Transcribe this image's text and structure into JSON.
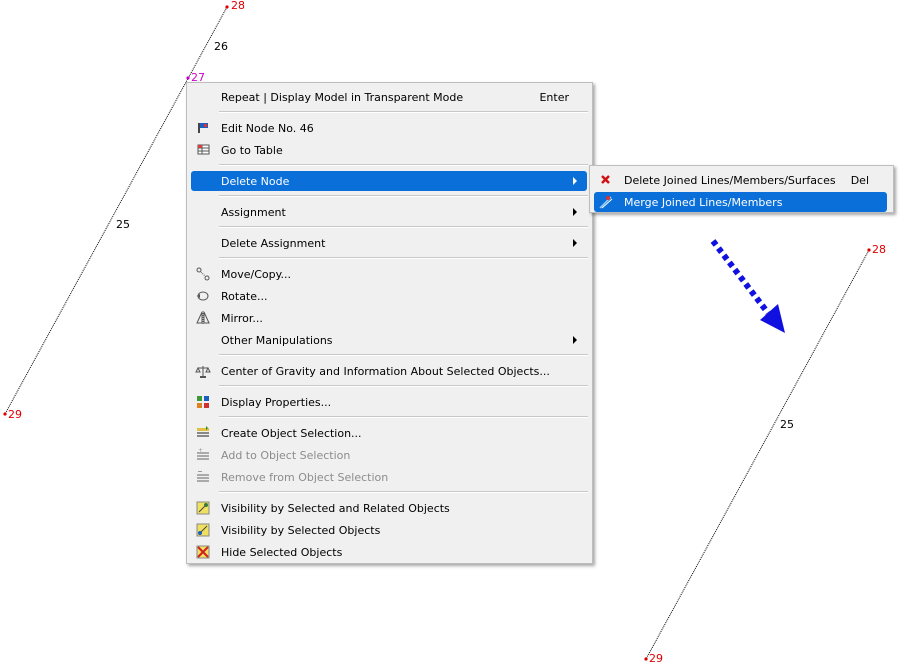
{
  "viewport": {
    "nodes_left": {
      "n28": "28",
      "n27": "27",
      "n29": "29"
    },
    "lines_left": {
      "a": "26",
      "b": "25"
    },
    "nodes_right": {
      "n28": "28",
      "n29": "29"
    },
    "lines_right": {
      "a": "25"
    }
  },
  "context_menu": {
    "repeat": {
      "label": "Repeat | Display Model in Transparent Mode",
      "shortcut": "Enter"
    },
    "edit_node": "Edit Node No. 46",
    "go_to_table": "Go to Table",
    "delete_node": "Delete Node",
    "assignment": "Assignment",
    "delete_assignment": "Delete Assignment",
    "move_copy": "Move/Copy...",
    "rotate": "Rotate...",
    "mirror": "Mirror...",
    "other_manipulations": "Other Manipulations",
    "center_of_gravity": "Center of Gravity and Information About Selected Objects...",
    "display_properties": "Display Properties...",
    "create_selection": "Create Object Selection...",
    "add_selection": "Add to Object Selection",
    "remove_selection": "Remove from Object Selection",
    "vis_selected_related": "Visibility by Selected and Related Objects",
    "vis_selected": "Visibility by Selected Objects",
    "hide_selected": "Hide Selected Objects"
  },
  "submenu": {
    "delete_joined": {
      "label": "Delete Joined Lines/Members/Surfaces",
      "shortcut": "Del"
    },
    "merge_joined": "Merge Joined Lines/Members"
  },
  "colors": {
    "highlight": "#0a6fd8",
    "node": "#e00000",
    "selected_node": "#d000d0",
    "arrow": "#1010e0"
  }
}
